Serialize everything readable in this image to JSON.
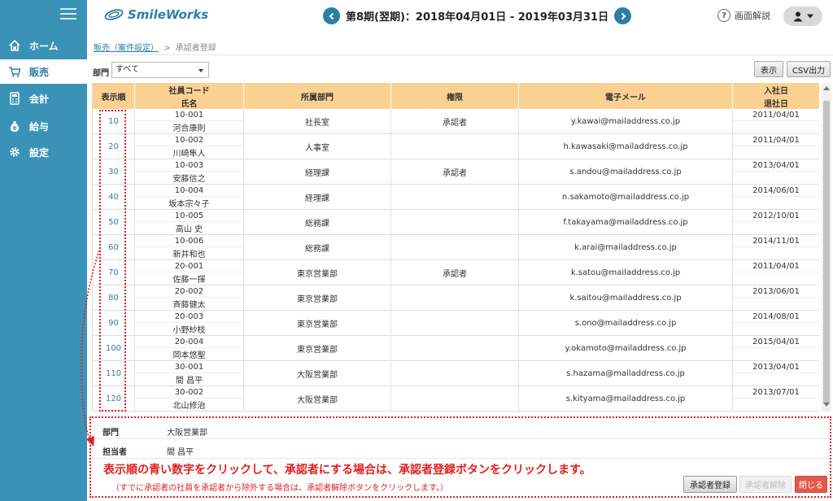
{
  "header": {
    "logo_text": "SmileWorks",
    "period": "第8期(翌期)：2018年04月01日 - 2019年03月31日",
    "help_label": "画面解説"
  },
  "sidebar": {
    "items": [
      {
        "label": "ホーム",
        "icon": "home-icon"
      },
      {
        "label": "販売",
        "icon": "cart-icon"
      },
      {
        "label": "会計",
        "icon": "calculator-icon"
      },
      {
        "label": "給与",
        "icon": "money-bag-icon"
      },
      {
        "label": "設定",
        "icon": "gear-icon"
      }
    ]
  },
  "breadcrumb": {
    "parent": "販売（案件設定）",
    "separator": ">",
    "current": "承認者登録"
  },
  "filter": {
    "dept_label": "部門",
    "dept_value": "すべて"
  },
  "toolbar": {
    "display_label": "表示",
    "csv_label": "CSV出力"
  },
  "table": {
    "headers": {
      "order": "表示順",
      "code": "社員コード",
      "name": "氏名",
      "dept": "所属部門",
      "role": "権限",
      "email": "電子メール",
      "join": "入社日",
      "leave": "退社日"
    },
    "rows": [
      {
        "order": "10",
        "code": "10-001",
        "name": "河合康則",
        "dept": "社長室",
        "role": "承認者",
        "email": "y.kawai@mailaddress.co.jp",
        "join": "2011/04/01",
        "leave": ""
      },
      {
        "order": "20",
        "code": "10-002",
        "name": "川崎隼人",
        "dept": "人事室",
        "role": "",
        "email": "h.kawasaki@mailaddress.co.jp",
        "join": "2011/04/01",
        "leave": ""
      },
      {
        "order": "30",
        "code": "10-003",
        "name": "安藤信之",
        "dept": "経理課",
        "role": "承認者",
        "email": "s.andou@mailaddress.co.jp",
        "join": "2013/04/01",
        "leave": ""
      },
      {
        "order": "40",
        "code": "10-004",
        "name": "坂本宗々子",
        "dept": "経理課",
        "role": "",
        "email": "n.sakamoto@mailaddress.co.jp",
        "join": "2014/06/01",
        "leave": ""
      },
      {
        "order": "50",
        "code": "10-005",
        "name": "高山 史",
        "dept": "総務課",
        "role": "",
        "email": "f.takayama@mailaddress.co.jp",
        "join": "2012/10/01",
        "leave": ""
      },
      {
        "order": "60",
        "code": "10-006",
        "name": "新井和也",
        "dept": "総務課",
        "role": "",
        "email": "k.arai@mailaddress.co.jp",
        "join": "2014/11/01",
        "leave": ""
      },
      {
        "order": "70",
        "code": "20-001",
        "name": "佐藤一揮",
        "dept": "東京営業部",
        "role": "承認者",
        "email": "k.satou@mailaddress.co.jp",
        "join": "2011/04/01",
        "leave": ""
      },
      {
        "order": "80",
        "code": "20-002",
        "name": "斉藤健太",
        "dept": "東京営業部",
        "role": "",
        "email": "k.saitou@mailaddress.co.jp",
        "join": "2013/06/01",
        "leave": ""
      },
      {
        "order": "90",
        "code": "20-003",
        "name": "小野紗枝",
        "dept": "東京営業部",
        "role": "",
        "email": "s.ono@mailaddress.co.jp",
        "join": "2014/08/01",
        "leave": ""
      },
      {
        "order": "100",
        "code": "20-004",
        "name": "岡本悠聖",
        "dept": "東京営業部",
        "role": "",
        "email": "y.okamoto@mailaddress.co.jp",
        "join": "2015/04/01",
        "leave": ""
      },
      {
        "order": "110",
        "code": "30-001",
        "name": "間 昌平",
        "dept": "大阪営業部",
        "role": "",
        "email": "s.hazama@mailaddress.co.jp",
        "join": "2013/04/01",
        "leave": ""
      },
      {
        "order": "120",
        "code": "30-002",
        "name": "北山修治",
        "dept": "大阪営業部",
        "role": "",
        "email": "s.kityama@mailaddress.co.jp",
        "join": "2013/07/01",
        "leave": ""
      }
    ]
  },
  "detail": {
    "dept_label": "部門",
    "dept_value": "大阪営業部",
    "person_label": "担当者",
    "person_value": "間 昌平"
  },
  "annotation": {
    "main": "表示順の青い数字をクリックして、承認者にする場合は、承認者登録ボタンをクリックします。",
    "sub": "（すでに承認者の社員を承認者から除外する場合は、承認者解除ボタンをクリックします。）"
  },
  "footer": {
    "register_label": "承認者登録",
    "unregister_label": "承認者解除",
    "close_label": "閉じる"
  },
  "colors": {
    "sidebar": "#3a93b6",
    "accent": "#2b7fa5",
    "table_header": "#fbd192",
    "annotation_red": "#e02020",
    "close_button": "#e05a4a"
  }
}
